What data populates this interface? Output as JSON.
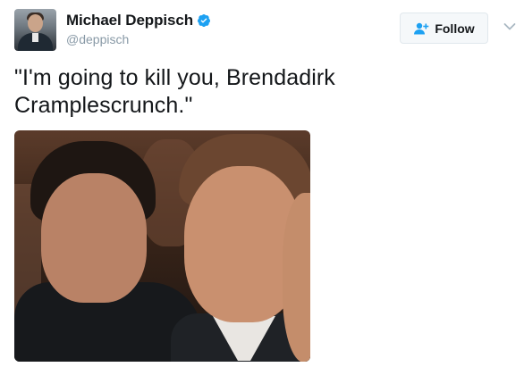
{
  "tweet": {
    "user": {
      "name": "Michael Deppisch",
      "handle": "@deppisch",
      "verified": true
    },
    "follow_label": "Follow",
    "text_line1": "\"I'm going to kill you, Brendadirk",
    "text_line2": "Cramplescrunch.\"",
    "icons": {
      "avatar": "avatar-photo",
      "verified": "verified-badge-icon",
      "follow": "follow-user-icon",
      "menu": "chevron-down-icon"
    },
    "colors": {
      "verified": "#1da1f2",
      "follow_icon": "#1da1f2",
      "handle": "#8899a6",
      "text": "#14171a"
    }
  }
}
